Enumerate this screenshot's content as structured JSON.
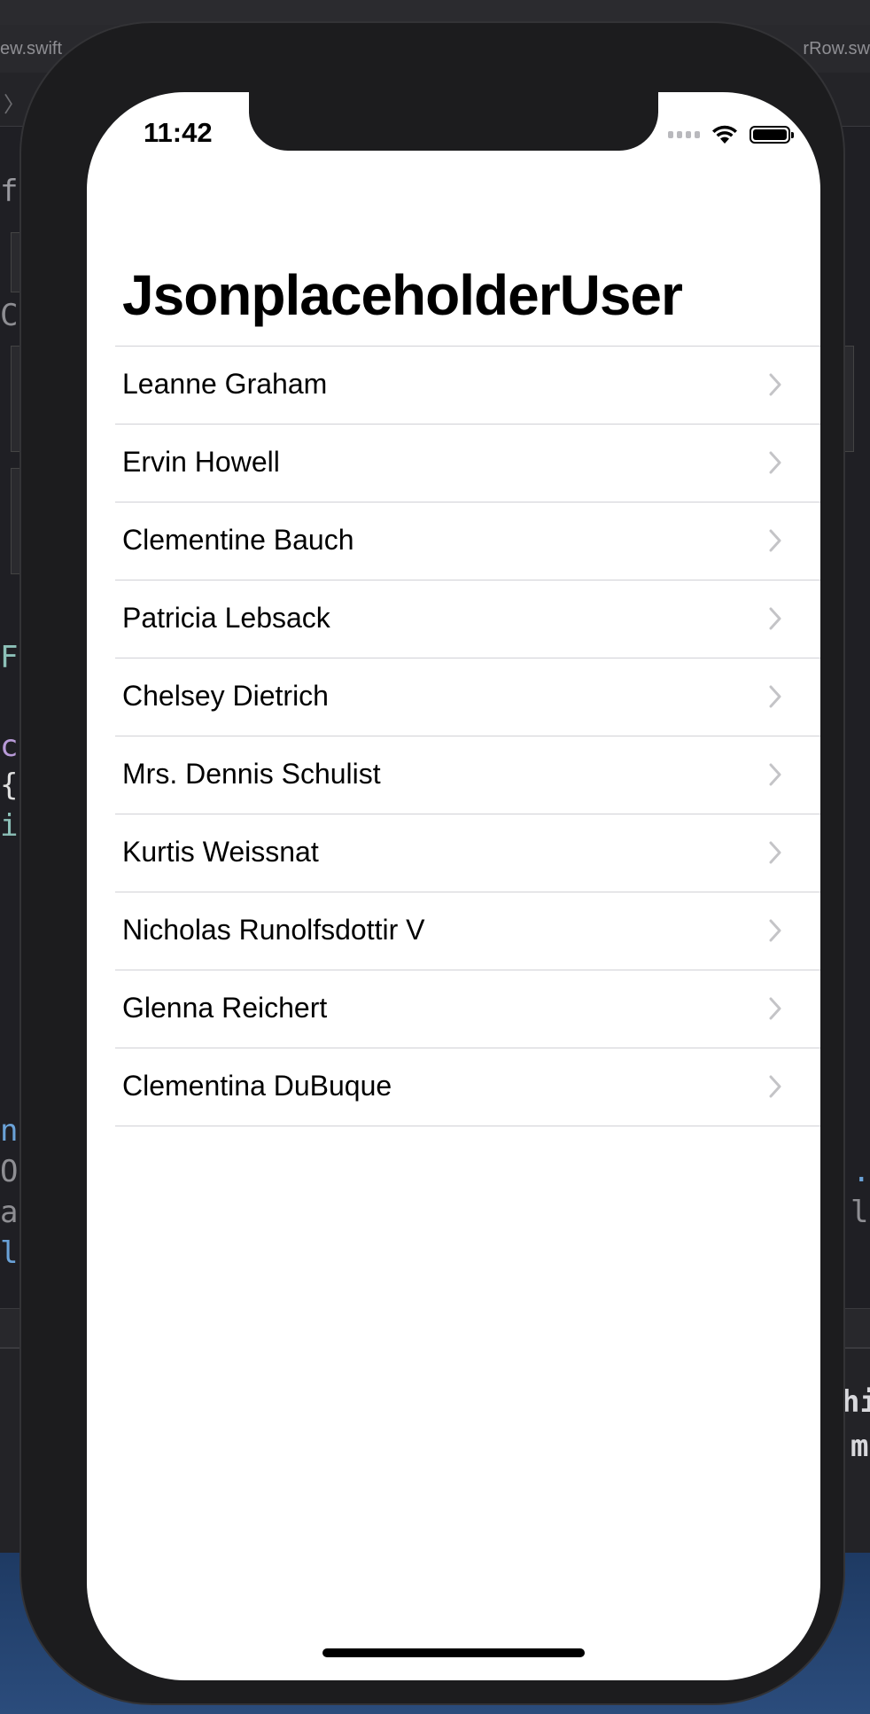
{
  "editor": {
    "tab_left": "ew.swift",
    "tab_right": "rRow.sw",
    "code_fragments_left": [
      "f",
      "C",
      "F",
      "c",
      "{",
      "i",
      "n",
      "O",
      "a",
      "l"
    ],
    "code_fragments_right": [
      ".",
      "l"
    ],
    "console_fragments": [
      "hi",
      "m"
    ]
  },
  "status_bar": {
    "time": "11:42"
  },
  "navigation": {
    "title": "JsonplaceholderUser"
  },
  "users": [
    {
      "name": "Leanne Graham"
    },
    {
      "name": "Ervin Howell"
    },
    {
      "name": "Clementine Bauch"
    },
    {
      "name": "Patricia Lebsack"
    },
    {
      "name": "Chelsey Dietrich"
    },
    {
      "name": "Mrs. Dennis Schulist"
    },
    {
      "name": "Kurtis Weissnat"
    },
    {
      "name": "Nicholas Runolfsdottir V"
    },
    {
      "name": "Glenna Reichert"
    },
    {
      "name": "Clementina DuBuque"
    }
  ],
  "icons": {
    "row_accessory": "chevron-right-icon",
    "status": [
      "cellular-signal-icon",
      "wifi-icon",
      "battery-icon"
    ]
  },
  "colors": {
    "screen_background": "#ffffff",
    "separator": "#d1d1d6",
    "chevron": "#c4c4c7",
    "device_frame": "#1c1c1e"
  }
}
